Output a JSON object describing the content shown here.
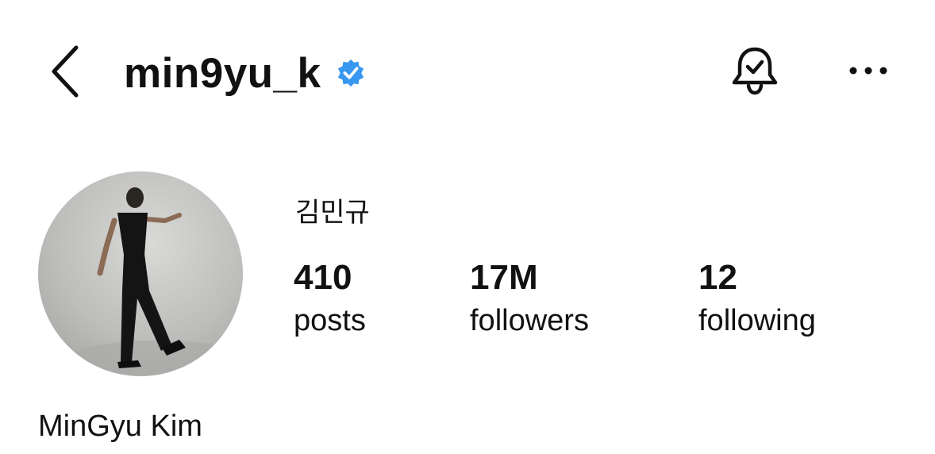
{
  "header": {
    "username": "min9yu_k",
    "verified": true,
    "back_icon": "chevron-left-icon",
    "bell_icon": "bell-check-icon",
    "more_icon": "more-horizontal-icon"
  },
  "profile": {
    "display_name_ko": "김민규",
    "full_name": "MinGyu Kim",
    "stats": {
      "posts": {
        "value": "410",
        "label": "posts"
      },
      "followers": {
        "value": "17M",
        "label": "followers"
      },
      "following": {
        "value": "12",
        "label": "following"
      }
    }
  },
  "colors": {
    "text": "#111111",
    "verified_badge": "#3897f0",
    "background": "#ffffff"
  }
}
